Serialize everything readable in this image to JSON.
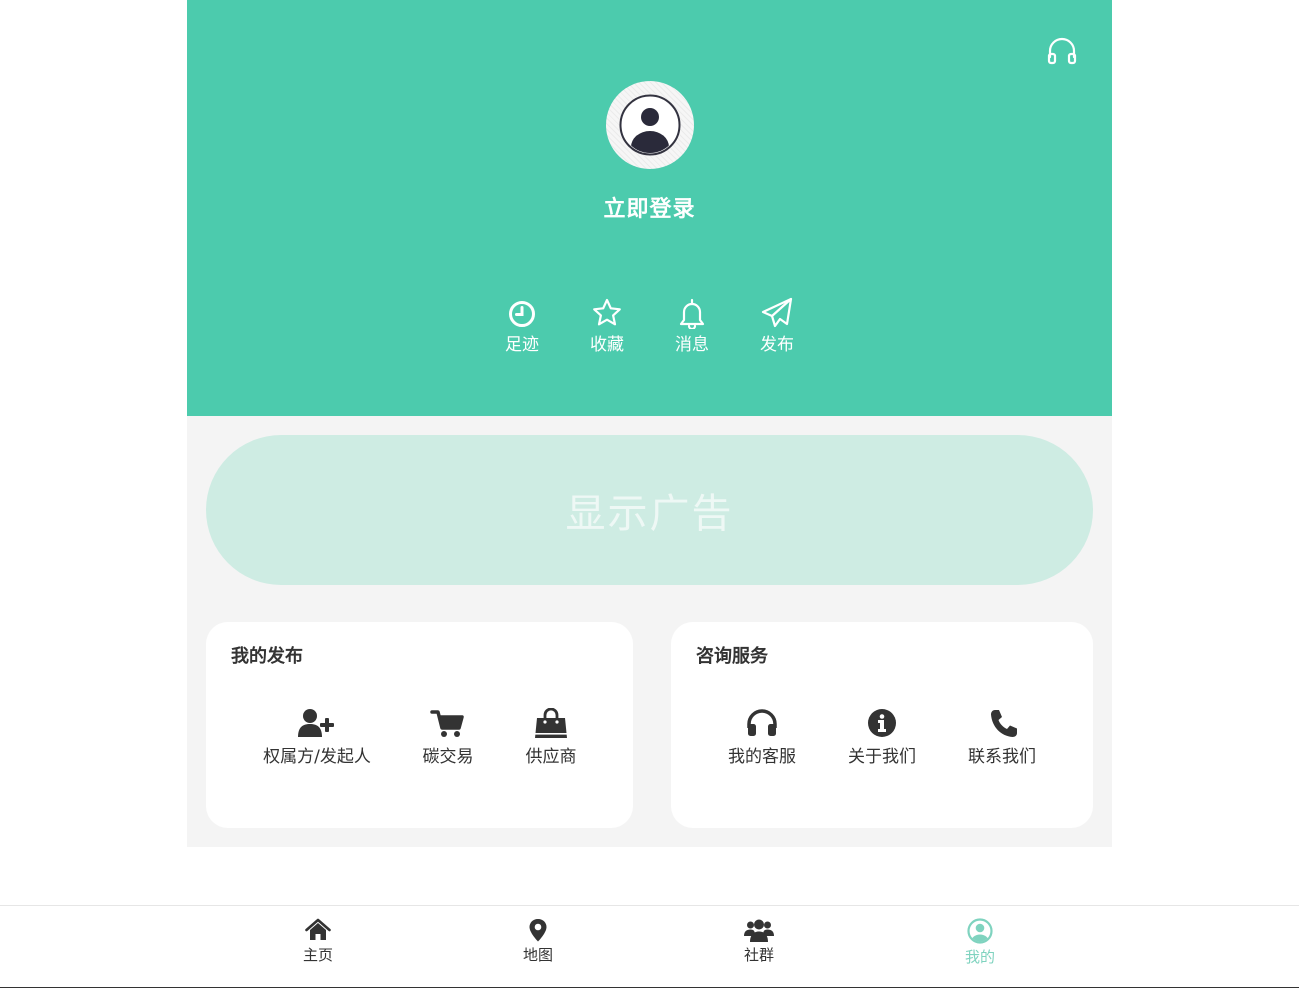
{
  "colors": {
    "brand": "#4ccbad",
    "page_background": "#f4f4f4",
    "ad_background": "#ceece3",
    "active_tab": "#7fd3bf",
    "text_dark": "#333333"
  },
  "header": {
    "support_icon": "headphones-icon",
    "avatar_icon": "user-avatar-icon",
    "login_label": "立即登录",
    "quick_links": [
      {
        "label": "足迹",
        "icon": "clock-icon"
      },
      {
        "label": "收藏",
        "icon": "star-icon"
      },
      {
        "label": "消息",
        "icon": "bell-icon"
      },
      {
        "label": "发布",
        "icon": "paper-plane-icon"
      }
    ]
  },
  "ad": {
    "label": "显示广告"
  },
  "my_posts": {
    "title": "我的发布",
    "items": [
      {
        "label": "权属方/发起人",
        "icon": "user-plus-icon"
      },
      {
        "label": "碳交易",
        "icon": "cart-icon"
      },
      {
        "label": "供应商",
        "icon": "shopping-bag-icon"
      }
    ]
  },
  "consult": {
    "title": "咨询服务",
    "items": [
      {
        "label": "我的客服",
        "icon": "headset-icon"
      },
      {
        "label": "关于我们",
        "icon": "info-icon"
      },
      {
        "label": "联系我们",
        "icon": "phone-icon"
      }
    ]
  },
  "tabbar": {
    "active_index": 3,
    "items": [
      {
        "label": "主页",
        "icon": "home-icon"
      },
      {
        "label": "地图",
        "icon": "map-marker-icon"
      },
      {
        "label": "社群",
        "icon": "users-icon"
      },
      {
        "label": "我的",
        "icon": "user-circle-icon"
      }
    ]
  }
}
